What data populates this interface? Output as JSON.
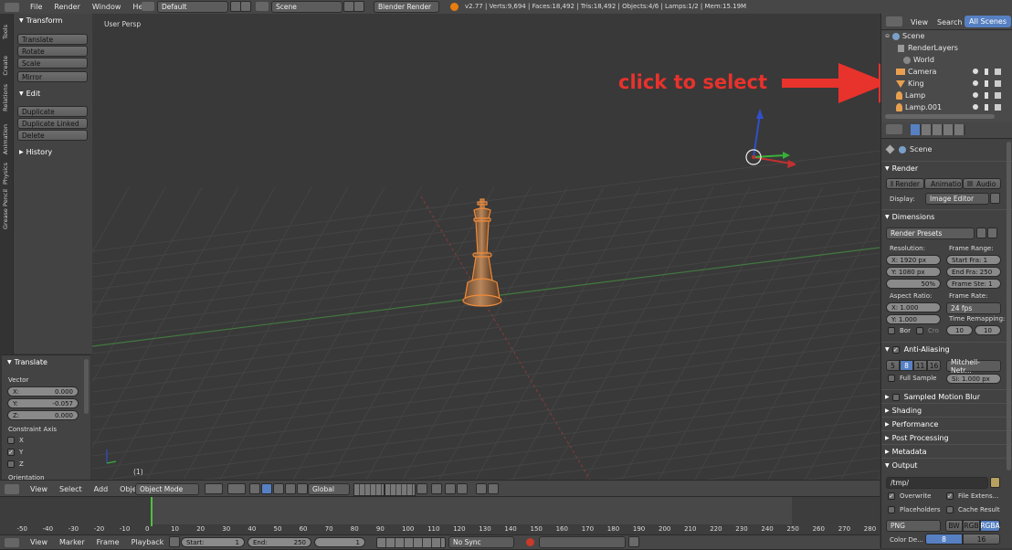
{
  "topbar": {
    "menus": [
      "File",
      "Render",
      "Window",
      "Help"
    ],
    "layout": "Default",
    "scene": "Scene",
    "engine": "Blender Render",
    "stats": "v2.77 | Verts:9,694 | Faces:18,492 | Tris:18,492 | Objects:4/6 | Lamps:1/2 | Mem:15.19M"
  },
  "lefttabs": [
    "Tools",
    "Create",
    "Relations",
    "Animation",
    "Physics",
    "Grease Pencil"
  ],
  "toolshelf": {
    "transform_title": "Transform",
    "transform_buttons": [
      "Translate",
      "Rotate",
      "Scale"
    ],
    "mirror": "Mirror",
    "edit_title": "Edit",
    "edit_buttons": [
      "Duplicate",
      "Duplicate Linked",
      "Delete"
    ],
    "history": "History"
  },
  "operator": {
    "title": "Translate",
    "vector_label": "Vector",
    "x_label": "X:",
    "x_value": "0.000",
    "y_label": "Y:",
    "y_value": "-0.057",
    "z_label": "Z:",
    "z_value": "0.000",
    "constraint_label": "Constraint Axis",
    "axes": [
      "X",
      "Y",
      "Z"
    ],
    "orientation": "Orientation"
  },
  "viewport": {
    "label": "User Persp",
    "frame": "(1)",
    "annotation": "click to select"
  },
  "viewheader": {
    "menus": [
      "View",
      "Select",
      "Add",
      "Object"
    ],
    "mode": "Object Mode",
    "orientation": "Global"
  },
  "outliner": {
    "tabs": [
      "View",
      "Search",
      "All Scenes"
    ],
    "items": [
      "Scene",
      "RenderLayers",
      "World",
      "Camera",
      "King",
      "Lamp",
      "Lamp.001"
    ]
  },
  "properties": {
    "context": "Scene",
    "render_title": "Render",
    "render_buttons": [
      "Render",
      "Animatio",
      "Audio"
    ],
    "display_label": "Display:",
    "display_value": "Image Editor",
    "dimensions_title": "Dimensions",
    "presets": "Render Presets",
    "resolution_label": "Resolution:",
    "res_x": "X:   1920 px",
    "res_y": "Y:   1080 px",
    "res_pct": "50%",
    "frame_range_label": "Frame Range:",
    "start_fra": "Start Fra:   1",
    "end_fra": "End Fra: 250",
    "frame_step": "Frame Ste: 1",
    "aspect_label": "Aspect Ratio:",
    "asp_x": "X:   1.000",
    "asp_y": "Y:   1.000",
    "frame_rate_label": "Frame Rate:",
    "fps": "24 fps",
    "time_remap_label": "Time Remapping:",
    "remap_old": "10",
    "remap_new": "10",
    "bor": "Bor",
    "cro": "Cro",
    "aa_title": "Anti-Aliasing",
    "aa_samples": [
      "5",
      "8",
      "11",
      "16"
    ],
    "aa_filter": "Mitchell-Netr...",
    "full_sample": "Full Sample",
    "size": "Si: 1.000 px",
    "collapsed": [
      "Sampled Motion Blur",
      "Shading",
      "Performance",
      "Post Processing",
      "Metadata"
    ],
    "output_title": "Output",
    "output_path": "/tmp/",
    "overwrite": "Overwrite",
    "file_ext": "File Extens...",
    "placeholders": "Placeholders",
    "cache_result": "Cache Result",
    "format": "PNG",
    "color_modes": [
      "BW",
      "RGB",
      "RGBA"
    ],
    "color_depth_label": "Color De...",
    "depths": [
      "8",
      "16"
    ]
  },
  "timeline": {
    "ticks": [
      "-50",
      "-40",
      "-30",
      "-20",
      "-10",
      "0",
      "10",
      "20",
      "30",
      "40",
      "50",
      "60",
      "70",
      "80",
      "90",
      "100",
      "110",
      "120",
      "130",
      "140",
      "150",
      "160",
      "170",
      "180",
      "190",
      "200",
      "210",
      "220",
      "230",
      "240",
      "250",
      "260",
      "270",
      "280"
    ],
    "menus": [
      "View",
      "Marker",
      "Frame",
      "Playback"
    ],
    "start": "Start:",
    "start_value": "1",
    "end": "End:",
    "end_value": "250",
    "current": "1",
    "sync": "No Sync"
  },
  "colors": {
    "annotation": "#e8322c",
    "accent": "#5680c2",
    "selected": "#f08b3a"
  }
}
